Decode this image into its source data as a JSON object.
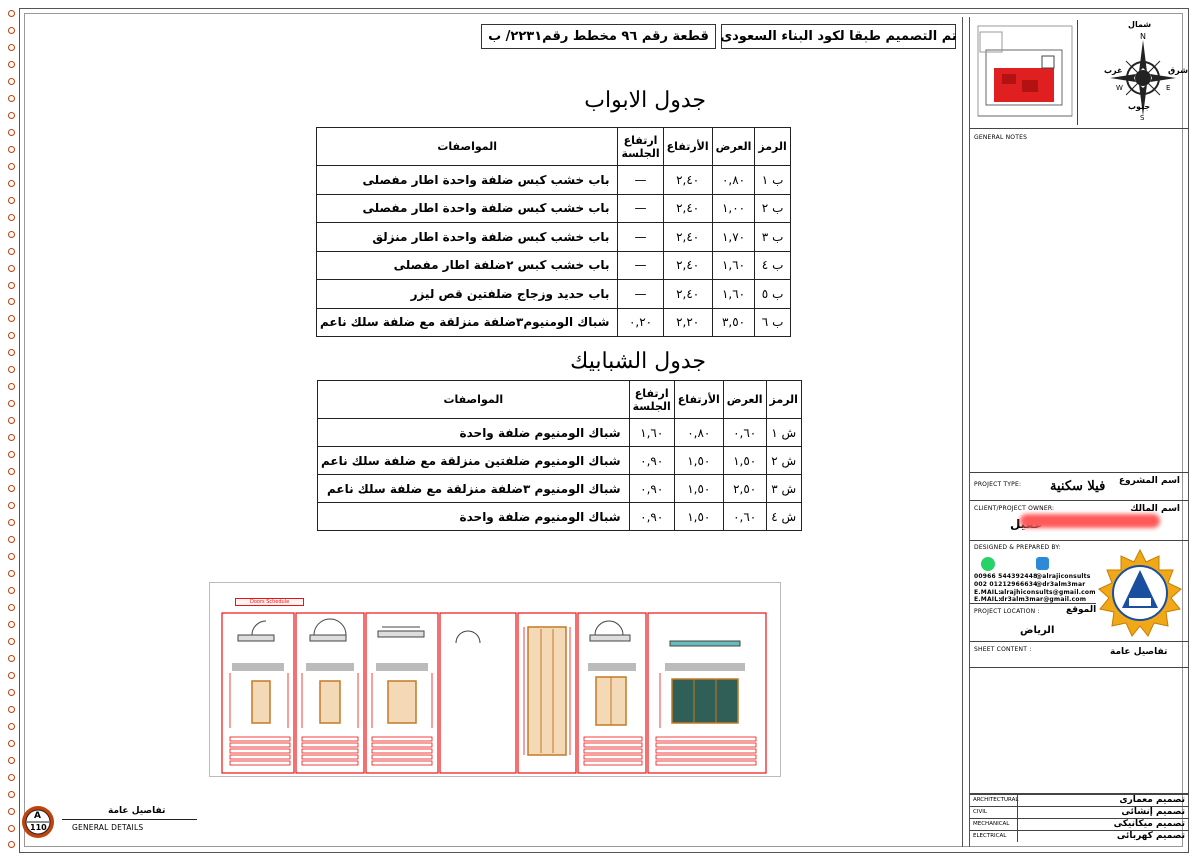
{
  "header": {
    "code_note": "تم التصميم طبقا لكود البناء السعودى",
    "plot_info": "قطعة رقم ٩٦    مخطط رقم٢٢٣١/ ب"
  },
  "doors": {
    "title": "جدول الابواب",
    "columns": [
      "الرمز",
      "العرض",
      "الأرتفاع",
      "ارتفاع الجلسة",
      "المواصفات"
    ],
    "rows": [
      [
        "ب ١",
        "٠,٨٠",
        "٢,٤٠",
        "—",
        "باب خشب كبس ضلفة واحدة اطار مفصلى"
      ],
      [
        "ب ٢",
        "١,٠٠",
        "٢,٤٠",
        "—",
        "باب خشب كبس ضلفة واحدة اطار مفصلى"
      ],
      [
        "ب ٣",
        "١,٧٠",
        "٢,٤٠",
        "—",
        "باب خشب كبس ضلفة واحدة اطار منزلق"
      ],
      [
        "ب ٤",
        "١,٦٠",
        "٢,٤٠",
        "—",
        "باب خشب كبس ٢ضلفة اطار مفصلى"
      ],
      [
        "ب ٥",
        "١,٦٠",
        "٢,٤٠",
        "—",
        "باب حديد وزجاج ضلفتين قص ليزر"
      ],
      [
        "ب ٦",
        "٣,٥٠",
        "٢,٢٠",
        "٠,٢٠",
        "شباك الومنيوم٣ضلفة منزلقة مع ضلفة سلك ناعم"
      ]
    ]
  },
  "windows": {
    "title": "جدول الشبابيك",
    "columns": [
      "الرمز",
      "العرض",
      "الأرتفاع",
      "ارتفاع الجلسة",
      "المواصفات"
    ],
    "rows": [
      [
        "ش ١",
        "٠,٦٠",
        "٠,٨٠",
        "١,٦٠",
        "شباك الومنيوم ضلفة واحدة"
      ],
      [
        "ش ٢",
        "١,٥٠",
        "١,٥٠",
        "٠,٩٠",
        "شباك الومنيوم ضلفتين منزلقة مع ضلفة سلك ناعم"
      ],
      [
        "ش ٣",
        "٢,٥٠",
        "١,٥٠",
        "٠,٩٠",
        "شباك الومنيوم ٣ضلفة منزلقة مع ضلفة سلك ناعم"
      ],
      [
        "ش ٤",
        "٠,٦٠",
        "١,٥٠",
        "٠,٩٠",
        "شباك الومنيوم ضلفة واحدة"
      ]
    ]
  },
  "drawing": {
    "label": "Doors Schedule"
  },
  "compass": {
    "n_letter": "N",
    "s_letter": "S",
    "e_letter": "E",
    "w_letter": "W",
    "north_ar": "شمال",
    "south_ar": "جنوب",
    "east_ar": "شرق",
    "west_ar": "غرب"
  },
  "title_block": {
    "general_notes_label": "GENERAL NOTES",
    "project_type_label": "PROJECT TYPE:",
    "project_type_ar_label": "اسم المشروع",
    "project_type_value": "فيلا سكنية",
    "client_label": "CLIENT/PROJECT OWNER:",
    "client_ar_label": "اسم المالك",
    "client_value_visible": "عقيل",
    "designed_label": "DESIGNED & PREPARED BY:",
    "phone1": "00966 544392448",
    "handle1": "@alrajiconsults",
    "phone2": "002 01212966634",
    "handle2": "@dr3alm3mar",
    "email1_label": "E.MAIL:",
    "email1": "alrajhiconsults@gmail.com",
    "email2_label": "E.MAIL:",
    "email2": "dr3alm3mar@gmail.com",
    "location_label": "PROJECT LOCATION :",
    "location_ar_label": "الموقع",
    "location_value": "الرياض",
    "sheet_label": "SHEET CONTENT :",
    "sheet_value": "تفاصيل عامة",
    "disciplines": [
      {
        "en": "ARCHITECTURAL",
        "ar": "تصميم معمارى"
      },
      {
        "en": "CIVIL",
        "ar": "تصميم إنشائى"
      },
      {
        "en": "MECHANICAL",
        "ar": "تصميم ميكانيكى"
      },
      {
        "en": "ELECTRICAL",
        "ar": "تصميم كهربائى"
      }
    ]
  },
  "sheet_badge": {
    "letter": "A",
    "number": "110",
    "title_ar": "تفاصيل عامة",
    "title_en": "GENERAL DETAILS"
  },
  "colors": {
    "ring": "#c2410c",
    "redline": "#e11111",
    "wood": "#c47a26",
    "logo_gold": "#f0a818",
    "logo_blue": "#1a4fa0"
  }
}
